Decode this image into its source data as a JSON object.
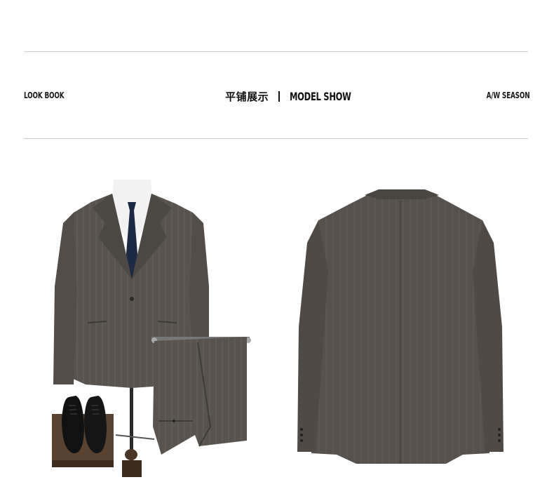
{
  "header": {
    "left_label": "LOOK BOOK",
    "center_cn": "平铺展示",
    "center_en": "MODEL SHOW",
    "right_label": "A/W SEASON"
  },
  "photos": {
    "front": "suit-front-with-trousers-and-shoes",
    "back": "suit-jacket-back"
  },
  "colors": {
    "suit": "#58534e",
    "suit_dark": "#3f3b37",
    "rule": "#cfcfcf",
    "tie": "#1e2a44"
  }
}
